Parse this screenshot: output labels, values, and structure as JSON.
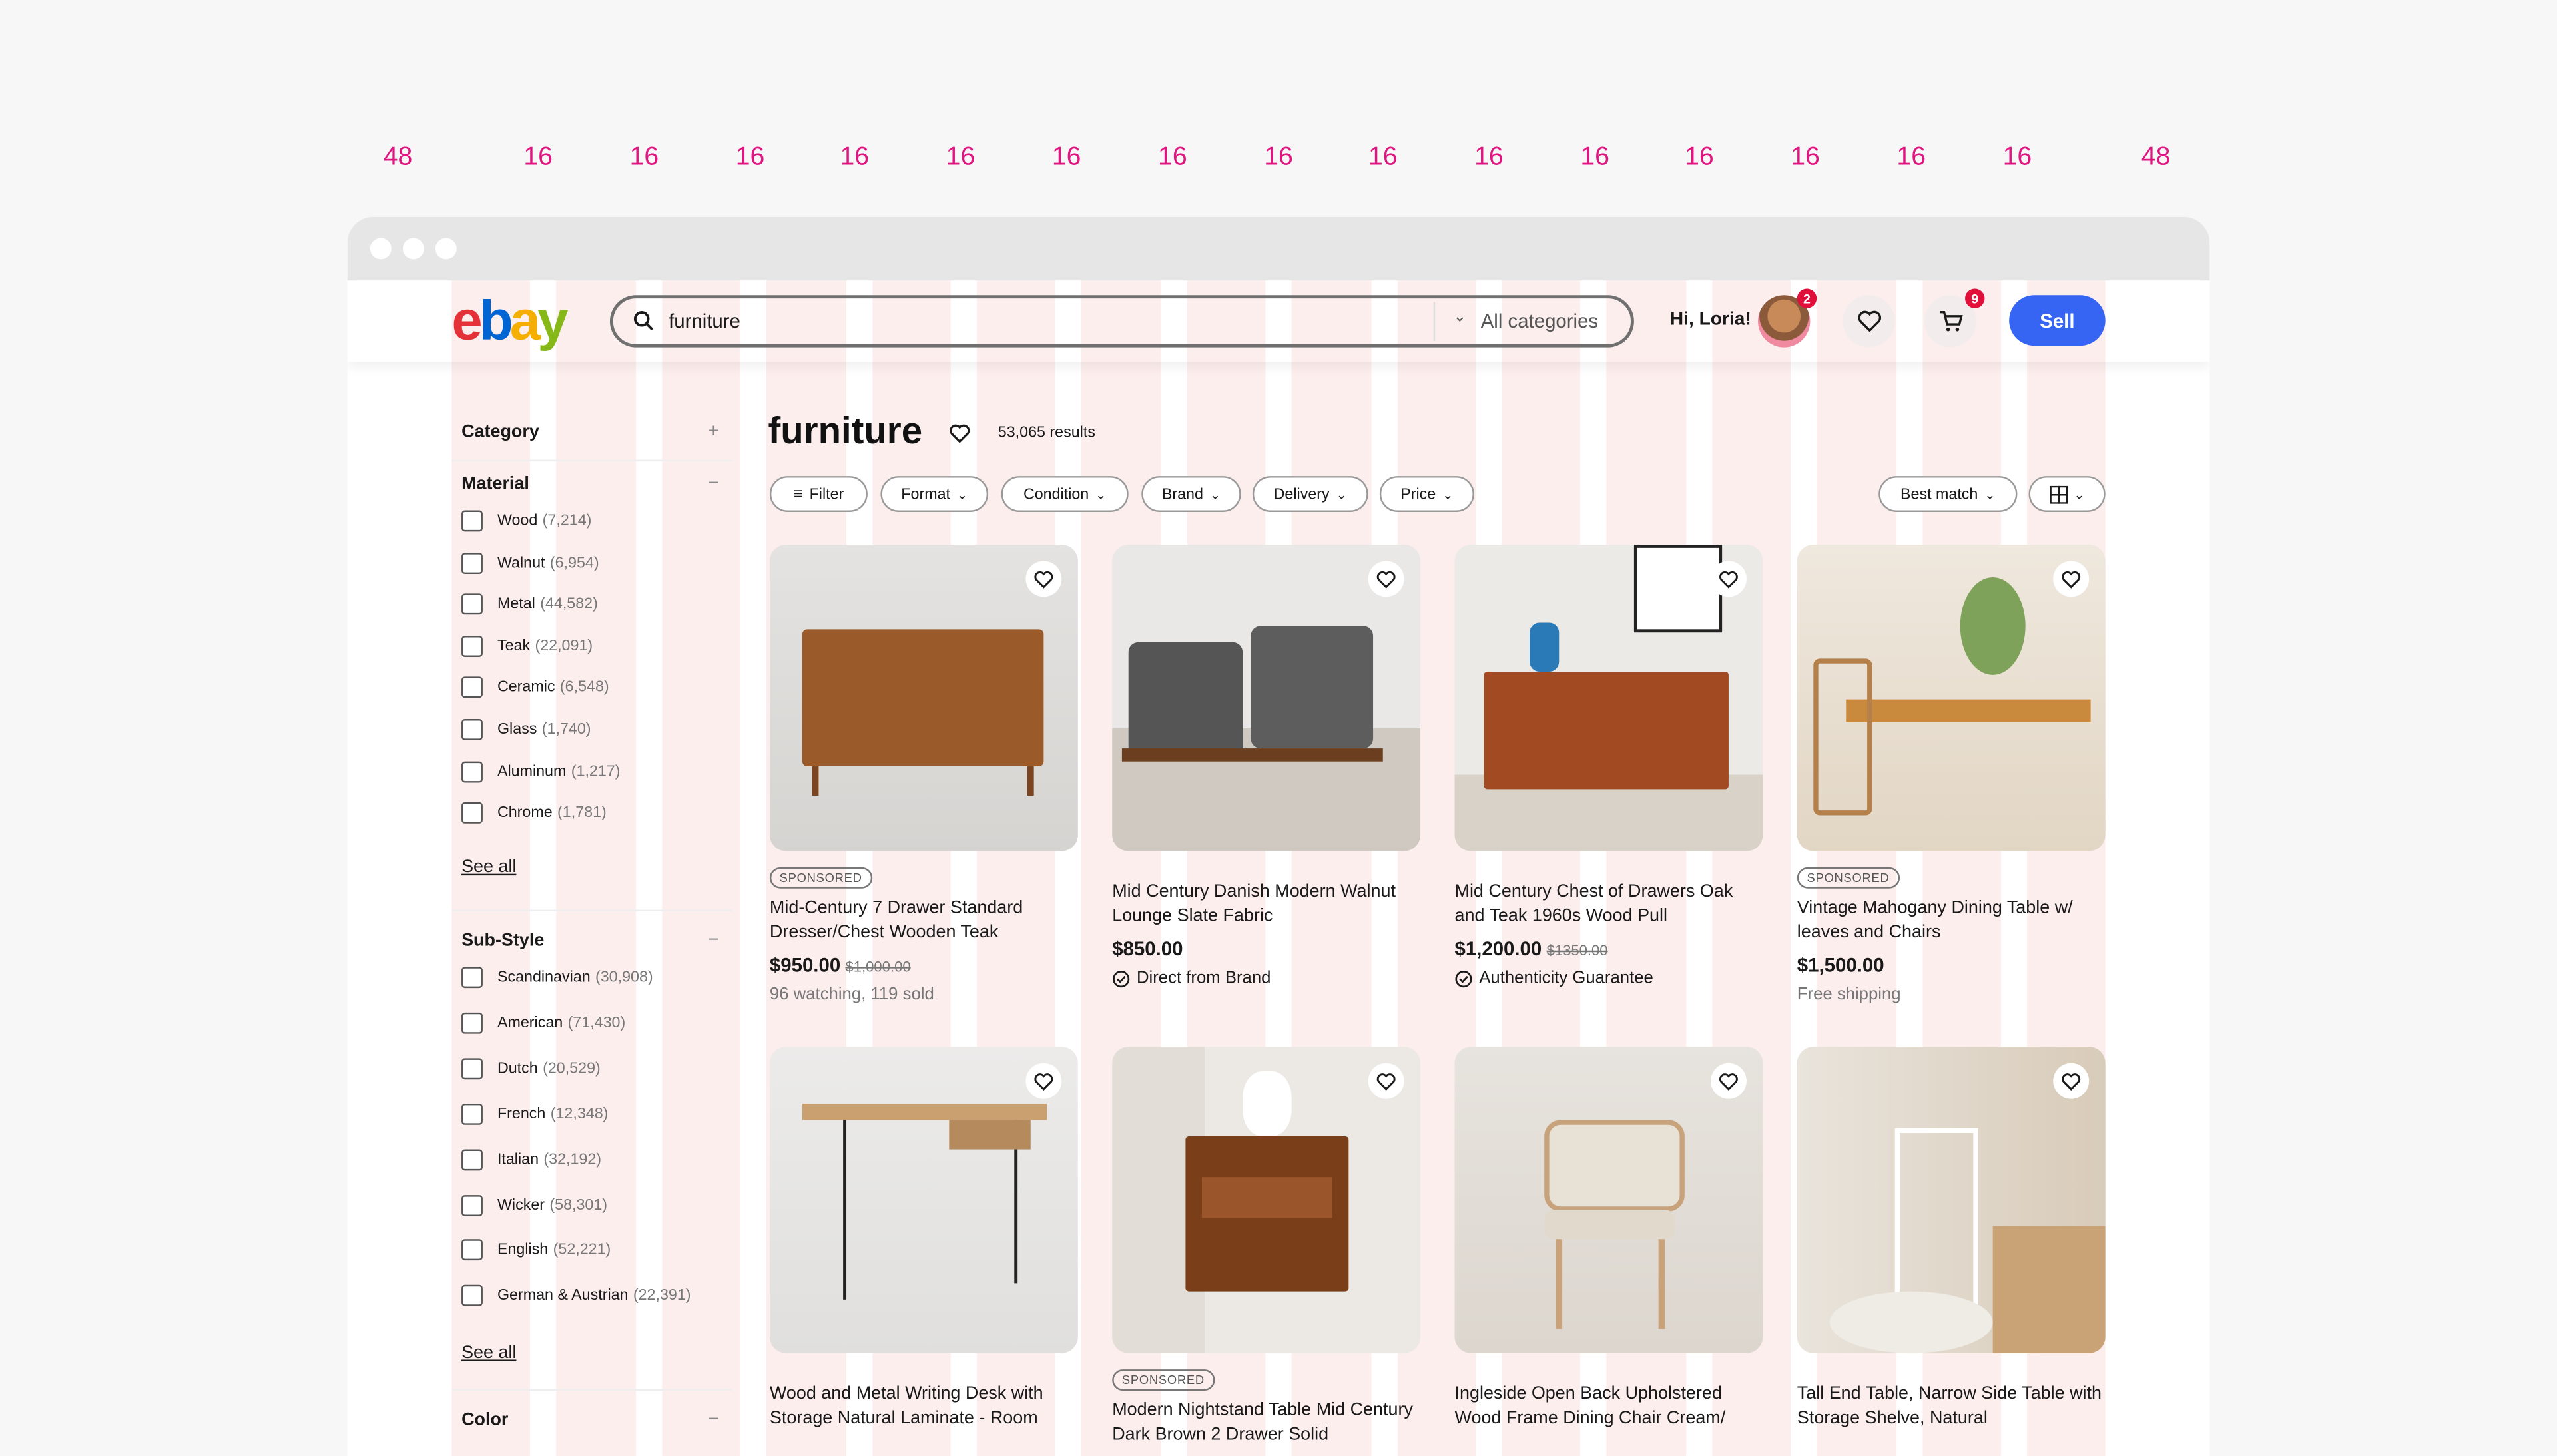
{
  "grid_labels": [
    "48",
    "16",
    "16",
    "16",
    "16",
    "16",
    "16",
    "16",
    "16",
    "16",
    "16",
    "16",
    "16",
    "16",
    "16",
    "16",
    "48"
  ],
  "colors": {
    "grid_label": "#e0157f",
    "grid_stripe": "#fdeeee",
    "sell": "#3665f3",
    "badge": "#e0103a",
    "logo": [
      "#e53238",
      "#0064d2",
      "#f5af02",
      "#86b817"
    ]
  },
  "header": {
    "logo": [
      "e",
      "b",
      "a",
      "y"
    ],
    "search_value": "furniture",
    "category_select": "All categories",
    "greeting": "Hi, Loria!",
    "notifications_count": "2",
    "cart_count": "9",
    "sell_label": "Sell"
  },
  "sidebar": {
    "category": {
      "title": "Category",
      "toggle": "+"
    },
    "material": {
      "title": "Material",
      "toggle": "−",
      "see_all": "See all",
      "items": [
        {
          "label": "Wood",
          "count": "(7,214)"
        },
        {
          "label": "Walnut",
          "count": "(6,954)"
        },
        {
          "label": "Metal",
          "count": "(44,582)"
        },
        {
          "label": "Teak",
          "count": "(22,091)"
        },
        {
          "label": "Ceramic",
          "count": "(6,548)"
        },
        {
          "label": "Glass",
          "count": "(1,740)"
        },
        {
          "label": "Aluminum",
          "count": "(1,217)"
        },
        {
          "label": "Chrome",
          "count": "(1,781)"
        }
      ]
    },
    "substyle": {
      "title": "Sub-Style",
      "toggle": "−",
      "see_all": "See all",
      "items": [
        {
          "label": "Scandinavian",
          "count": "(30,908)"
        },
        {
          "label": "American",
          "count": "(71,430)"
        },
        {
          "label": "Dutch",
          "count": "(20,529)"
        },
        {
          "label": "French",
          "count": "(12,348)"
        },
        {
          "label": "Italian",
          "count": "(32,192)"
        },
        {
          "label": "Wicker",
          "count": "(58,301)"
        },
        {
          "label": "English",
          "count": "(52,221)"
        },
        {
          "label": "German & Austrian",
          "count": "(22,391)"
        }
      ]
    },
    "color": {
      "title": "Color",
      "toggle": "−"
    }
  },
  "main": {
    "title": "furniture",
    "results": "53,065 results",
    "filters": [
      "Filter",
      "Format",
      "Condition",
      "Brand",
      "Delivery",
      "Price"
    ],
    "sort": "Best match",
    "listings": [
      {
        "sponsored": "SPONSORED",
        "title": "Mid-Century 7 Drawer Standard Dresser/Chest Wooden Teak",
        "price": "$950.00",
        "old_price": "$1,000.00",
        "subtitle": "96 watching, 119 sold",
        "subtitle_style": "gray",
        "icon": "",
        "img": "dresser"
      },
      {
        "sponsored": "",
        "title": "Mid Century Danish Modern Walnut Lounge Slate Fabric",
        "price": "$850.00",
        "old_price": "",
        "subtitle": "Direct from Brand",
        "subtitle_style": "dark",
        "icon": "verified-check-icon",
        "img": "chairs"
      },
      {
        "sponsored": "",
        "title": "Mid Century Chest of Drawers Oak and Teak 1960s Wood Pull",
        "price": "$1,200.00",
        "old_price": "$1350.00",
        "subtitle": "Authenticity Guarantee",
        "subtitle_style": "dark",
        "icon": "verified-check-icon",
        "img": "sideboard"
      },
      {
        "sponsored": "SPONSORED",
        "title": "Vintage Mahogany Dining Table w/ leaves and Chairs",
        "price": "$1,500.00",
        "old_price": "",
        "subtitle": "Free shipping",
        "subtitle_style": "gray",
        "icon": "",
        "img": "dining"
      },
      {
        "sponsored": "",
        "title": "Wood and Metal Writing Desk with Storage Natural Laminate - Room",
        "price": "",
        "old_price": "",
        "subtitle": "",
        "icon": "",
        "img": "desk"
      },
      {
        "sponsored": "SPONSORED",
        "title": "Modern Nightstand Table Mid Century Dark Brown 2 Drawer Solid",
        "price": "",
        "old_price": "",
        "subtitle": "",
        "icon": "",
        "img": "nightstand"
      },
      {
        "sponsored": "",
        "title": "Ingleside Open Back Upholstered Wood Frame Dining Chair Cream/",
        "price": "",
        "old_price": "",
        "subtitle": "",
        "icon": "",
        "img": "chair"
      },
      {
        "sponsored": "",
        "title": "Tall End Table, Narrow Side Table with Storage Shelve, Natural",
        "price": "",
        "old_price": "",
        "subtitle": "",
        "icon": "",
        "img": "endtable"
      }
    ]
  }
}
